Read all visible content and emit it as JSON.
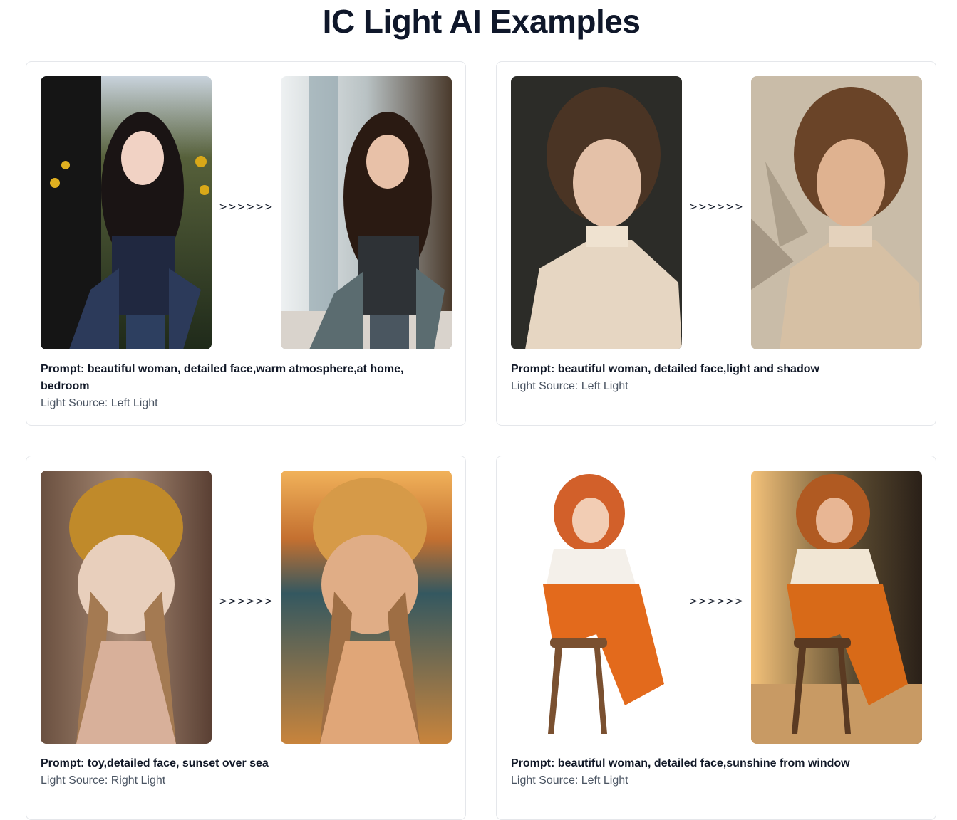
{
  "page": {
    "title": "IC Light AI Examples"
  },
  "examples": [
    {
      "before_alt": "woman among sunflowers, original",
      "after_alt": "woman in bedroom, relit",
      "arrow": ">>>>>>",
      "prompt": "Prompt: beautiful woman, detailed face,warm atmosphere,at home, bedroom",
      "light_source": "Light Source: Left Light"
    },
    {
      "before_alt": "woman in lace blouse, original",
      "after_alt": "woman in lace blouse with leaf shadows, relit",
      "arrow": ">>>>>>",
      "prompt": "Prompt: beautiful woman, detailed face,light and shadow",
      "light_source": "Light Source: Left Light"
    },
    {
      "before_alt": "knitted doll with yellow hat, original",
      "after_alt": "knitted doll at sunset over sea, relit",
      "arrow": ">>>>>>",
      "prompt": "Prompt: toy,detailed face, sunset over sea",
      "light_source": "Light Source: Right Light"
    },
    {
      "before_alt": "illustrated red-haired woman on stool, original",
      "after_alt": "red-haired woman on stool in sunshine, relit",
      "arrow": ">>>>>>",
      "prompt": "Prompt: beautiful woman, detailed face,sunshine from window",
      "light_source": "Light Source: Left Light"
    }
  ]
}
